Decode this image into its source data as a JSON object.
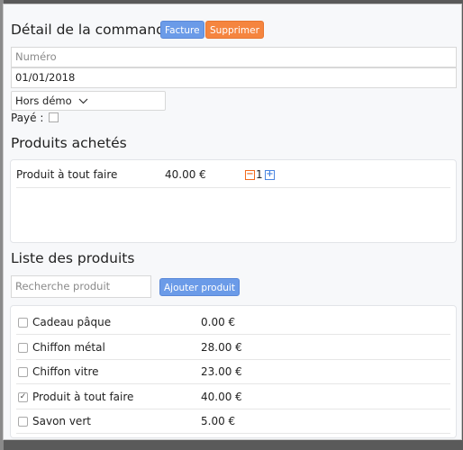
{
  "order": {
    "title": "Détail de la commande",
    "invoice_label": "Facture",
    "delete_label": "Supprimer",
    "number_placeholder": "Numéro",
    "number_value": "",
    "date_value": "01/01/2018",
    "mode_select": "Hors démo",
    "paid_label": "Payé :",
    "paid": false
  },
  "purchased": {
    "title": "Produits achetés",
    "items": [
      {
        "name": "Produit à tout faire",
        "price": "40.00 €",
        "quantity": "1"
      }
    ]
  },
  "catalog": {
    "title": "Liste des produits",
    "search_placeholder": "Recherche produit",
    "add_label": "Ajouter produit",
    "items": [
      {
        "name": "Cadeau pâque",
        "price": "0.00 €",
        "checked": false
      },
      {
        "name": "Chiffon métal",
        "price": "28.00 €",
        "checked": false
      },
      {
        "name": "Chiffon vitre",
        "price": "23.00 €",
        "checked": false
      },
      {
        "name": "Produit à tout faire",
        "price": "40.00 €",
        "checked": true
      },
      {
        "name": "Savon vert",
        "price": "5.00 €",
        "checked": false
      }
    ]
  },
  "colors": {
    "accent_blue": "#6b9be8",
    "accent_orange": "#f5853f"
  },
  "icons": {
    "minus": "−",
    "plus": "+",
    "chevron": "chevron-down-icon",
    "check": "✓"
  }
}
